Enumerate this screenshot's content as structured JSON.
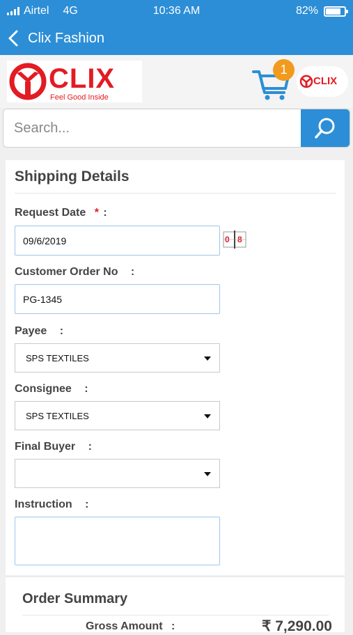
{
  "status_bar": {
    "carrier": "Airtel",
    "network": "4G",
    "time": "10:36 AM",
    "battery": "82%",
    "battery_level": 0.82
  },
  "nav": {
    "title": "Clix Fashion",
    "back_icon": "chevron-left-icon"
  },
  "brand": {
    "name": "CLIX",
    "tagline": "Feel Good Inside",
    "mini_name": "CLIX",
    "color": "#e31b23"
  },
  "cart": {
    "count": "1",
    "icon": "cart-icon"
  },
  "search": {
    "placeholder": "Search...",
    "value": "",
    "icon": "search-icon"
  },
  "form": {
    "heading": "Shipping Details",
    "request_date": {
      "label": "Request Date",
      "required_mark": "*",
      "colon": ":",
      "value": "09/6/2019",
      "calendar_icon": "calendar-icon"
    },
    "customer_order": {
      "label": "Customer Order No",
      "colon": ":",
      "value": "PG-1345"
    },
    "payee": {
      "label": "Payee",
      "colon": ":",
      "value": "SPS TEXTILES"
    },
    "consignee": {
      "label": "Consignee",
      "colon": ":",
      "value": "SPS TEXTILES"
    },
    "final_buyer": {
      "label": "Final Buyer",
      "colon": ":",
      "value": ""
    },
    "instruction": {
      "label": "Instruction",
      "colon": ":",
      "value": ""
    }
  },
  "summary": {
    "heading": "Order Summary",
    "gross_label": "Gross Amount",
    "gross_colon": ":",
    "gross_value": "₹ 7,290.00"
  },
  "colors": {
    "primary": "#2c8ed6",
    "badge": "#f29a1e",
    "brand_red": "#e31b23"
  }
}
